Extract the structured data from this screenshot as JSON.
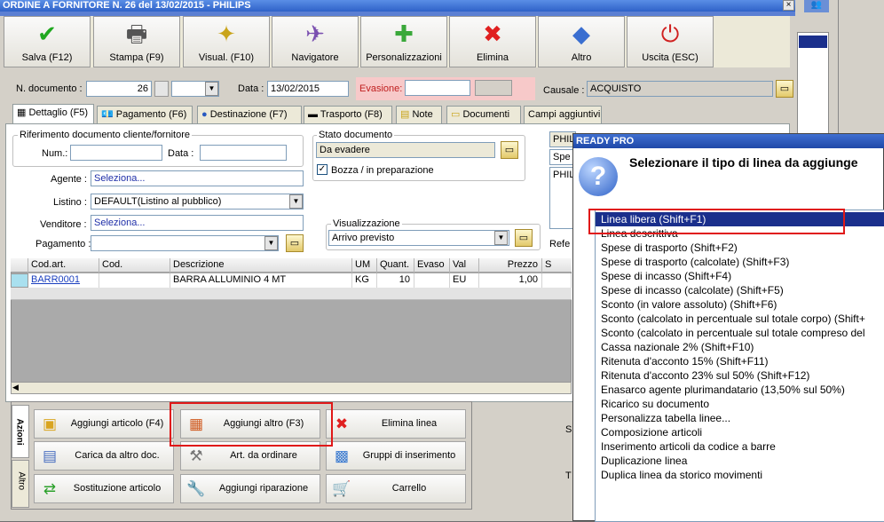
{
  "window": {
    "title": "ORDINE A FORNITORE N. 26 del 13/02/2015 - PHILIPS",
    "close": "×"
  },
  "toolbar": [
    {
      "label": "Salva (F12)",
      "icon": "checkmark-icon",
      "glyph": "✔",
      "color": "#1fa81f"
    },
    {
      "label": "Stampa (F9)",
      "icon": "printer-icon",
      "glyph": "🖶",
      "color": "#555"
    },
    {
      "label": "Visual. (F10)",
      "icon": "magic-wand-icon",
      "glyph": "✦",
      "color": "#c9a41a"
    },
    {
      "label": "Navigatore",
      "icon": "compass-icon",
      "glyph": "✈",
      "color": "#7a4fb0"
    },
    {
      "label": "Personalizzazioni",
      "icon": "puzzle-icon",
      "glyph": "✚",
      "color": "#3aa83a"
    },
    {
      "label": "Elimina",
      "icon": "delete-x-icon",
      "glyph": "✖",
      "color": "#e02020"
    },
    {
      "label": "Altro",
      "icon": "other-icon",
      "glyph": "◆",
      "color": "#3a6ed0"
    },
    {
      "label": "Uscita (ESC)",
      "icon": "exit-icon",
      "glyph": "⏻",
      "color": "#d02020"
    }
  ],
  "header": {
    "ndoc_label": "N. documento :",
    "ndoc_value": "26",
    "data_label": "Data :",
    "data_value": "13/02/2015",
    "evasione_label": "Evasione:",
    "causale_label": "Causale :",
    "causale_value": "ACQUISTO"
  },
  "tabs": [
    {
      "label": "Dettaglio (F5)",
      "icon": "📅"
    },
    {
      "label": "Pagamento (F6)",
      "icon": "💶"
    },
    {
      "label": "Destinazione (F7)",
      "icon": "🌐"
    },
    {
      "label": "Trasporto (F8)",
      "icon": "🚚"
    },
    {
      "label": "Note",
      "icon": "📝"
    },
    {
      "label": "Documenti",
      "icon": "📁"
    },
    {
      "label": "Campi aggiuntivi",
      "icon": ""
    }
  ],
  "riferimento": {
    "title": "Riferimento documento cliente/fornitore",
    "num_label": "Num.:",
    "data_label": "Data :"
  },
  "stato": {
    "title": "Stato documento",
    "value": "Da evadere",
    "bozza": "Bozza / in preparazione"
  },
  "fields": {
    "agente_label": "Agente :",
    "agente_value": "Seleziona...",
    "listino_label": "Listino :",
    "listino_value": "DEFAULT(Listino al pubblico)",
    "venditore_label": "Venditore :",
    "venditore_value": "Seleziona...",
    "pagamento_label": "Pagamento :"
  },
  "visualizzazione": {
    "title": "Visualizzazione",
    "value": "Arrivo previsto"
  },
  "right_partial": {
    "philips": "PHIL",
    "spe": "Spe",
    "philips2": "PHIL",
    "refe": "Refe"
  },
  "grid": {
    "headers": [
      "Cod.art.",
      "Cod.",
      "Descrizione",
      "UM",
      "Quant.",
      "Evaso",
      "Val",
      "Prezzo",
      "S"
    ],
    "rows": [
      [
        "BARR0001",
        "",
        "BARRA ALLUMINIO 4 MT",
        "KG",
        "10",
        "",
        "EU",
        "1,00",
        ""
      ]
    ]
  },
  "actions": {
    "vtab1": "Azioni",
    "vtab2": "Altro",
    "buttons": [
      {
        "label": "Aggiungi articolo (F4)",
        "icon": "add-article-icon",
        "glyph": "▣",
        "color": "#d9a520"
      },
      {
        "label": "Aggiungi altro (F3)",
        "icon": "add-other-icon",
        "glyph": "▦",
        "color": "#d05a20"
      },
      {
        "label": "Elimina linea",
        "icon": "delete-line-icon",
        "glyph": "✖",
        "color": "#e02020"
      },
      {
        "label": "Carica da altro doc.",
        "icon": "load-doc-icon",
        "glyph": "▤",
        "color": "#4a6fc0"
      },
      {
        "label": "Art. da ordinare",
        "icon": "order-article-icon",
        "glyph": "⚒",
        "color": "#777"
      },
      {
        "label": "Gruppi di inserimento",
        "icon": "insert-group-icon",
        "glyph": "▩",
        "color": "#3a7ad0"
      },
      {
        "label": "Sostituzione articolo",
        "icon": "replace-article-icon",
        "glyph": "⇄",
        "color": "#2aa02a"
      },
      {
        "label": "Aggiungi riparazione",
        "icon": "wrench-icon",
        "glyph": "🔧",
        "color": "#888"
      },
      {
        "label": "Carrello",
        "icon": "cart-icon",
        "glyph": "🛒",
        "color": "#666"
      }
    ],
    "side_s": "S",
    "side_t": "T"
  },
  "dialog": {
    "title": "READY PRO",
    "prompt": "Selezionare il tipo di linea da aggiunge",
    "items": [
      "Linea libera (Shift+F1)",
      "Linea descrittiva",
      "Spese di trasporto (Shift+F2)",
      "Spese di trasporto (calcolate) (Shift+F3)",
      "Spese di incasso (Shift+F4)",
      "Spese di incasso (calcolate) (Shift+F5)",
      "Sconto (in valore assoluto) (Shift+F6)",
      "Sconto (calcolato in percentuale sul totale corpo) (Shift+",
      "Sconto (calcolato in percentuale sul totale compreso del",
      "Cassa nazionale 2% (Shift+F10)",
      "Ritenuta d'acconto 15% (Shift+F11)",
      "Ritenuta d'acconto 23% sul 50% (Shift+F12)",
      "Enasarco agente plurimandatario (13,50% sul 50%)",
      "Ricarico su documento",
      "Personalizza tabella linee...",
      "Composizione articoli",
      "Inserimento articoli da codice a barre",
      "Duplicazione linea",
      "Duplica linea da storico movimenti"
    ],
    "selected_index": 0
  },
  "colors": {
    "highlight": "#e01818",
    "selection": "#1a2f8c",
    "titlebar": "#2f62c8"
  }
}
